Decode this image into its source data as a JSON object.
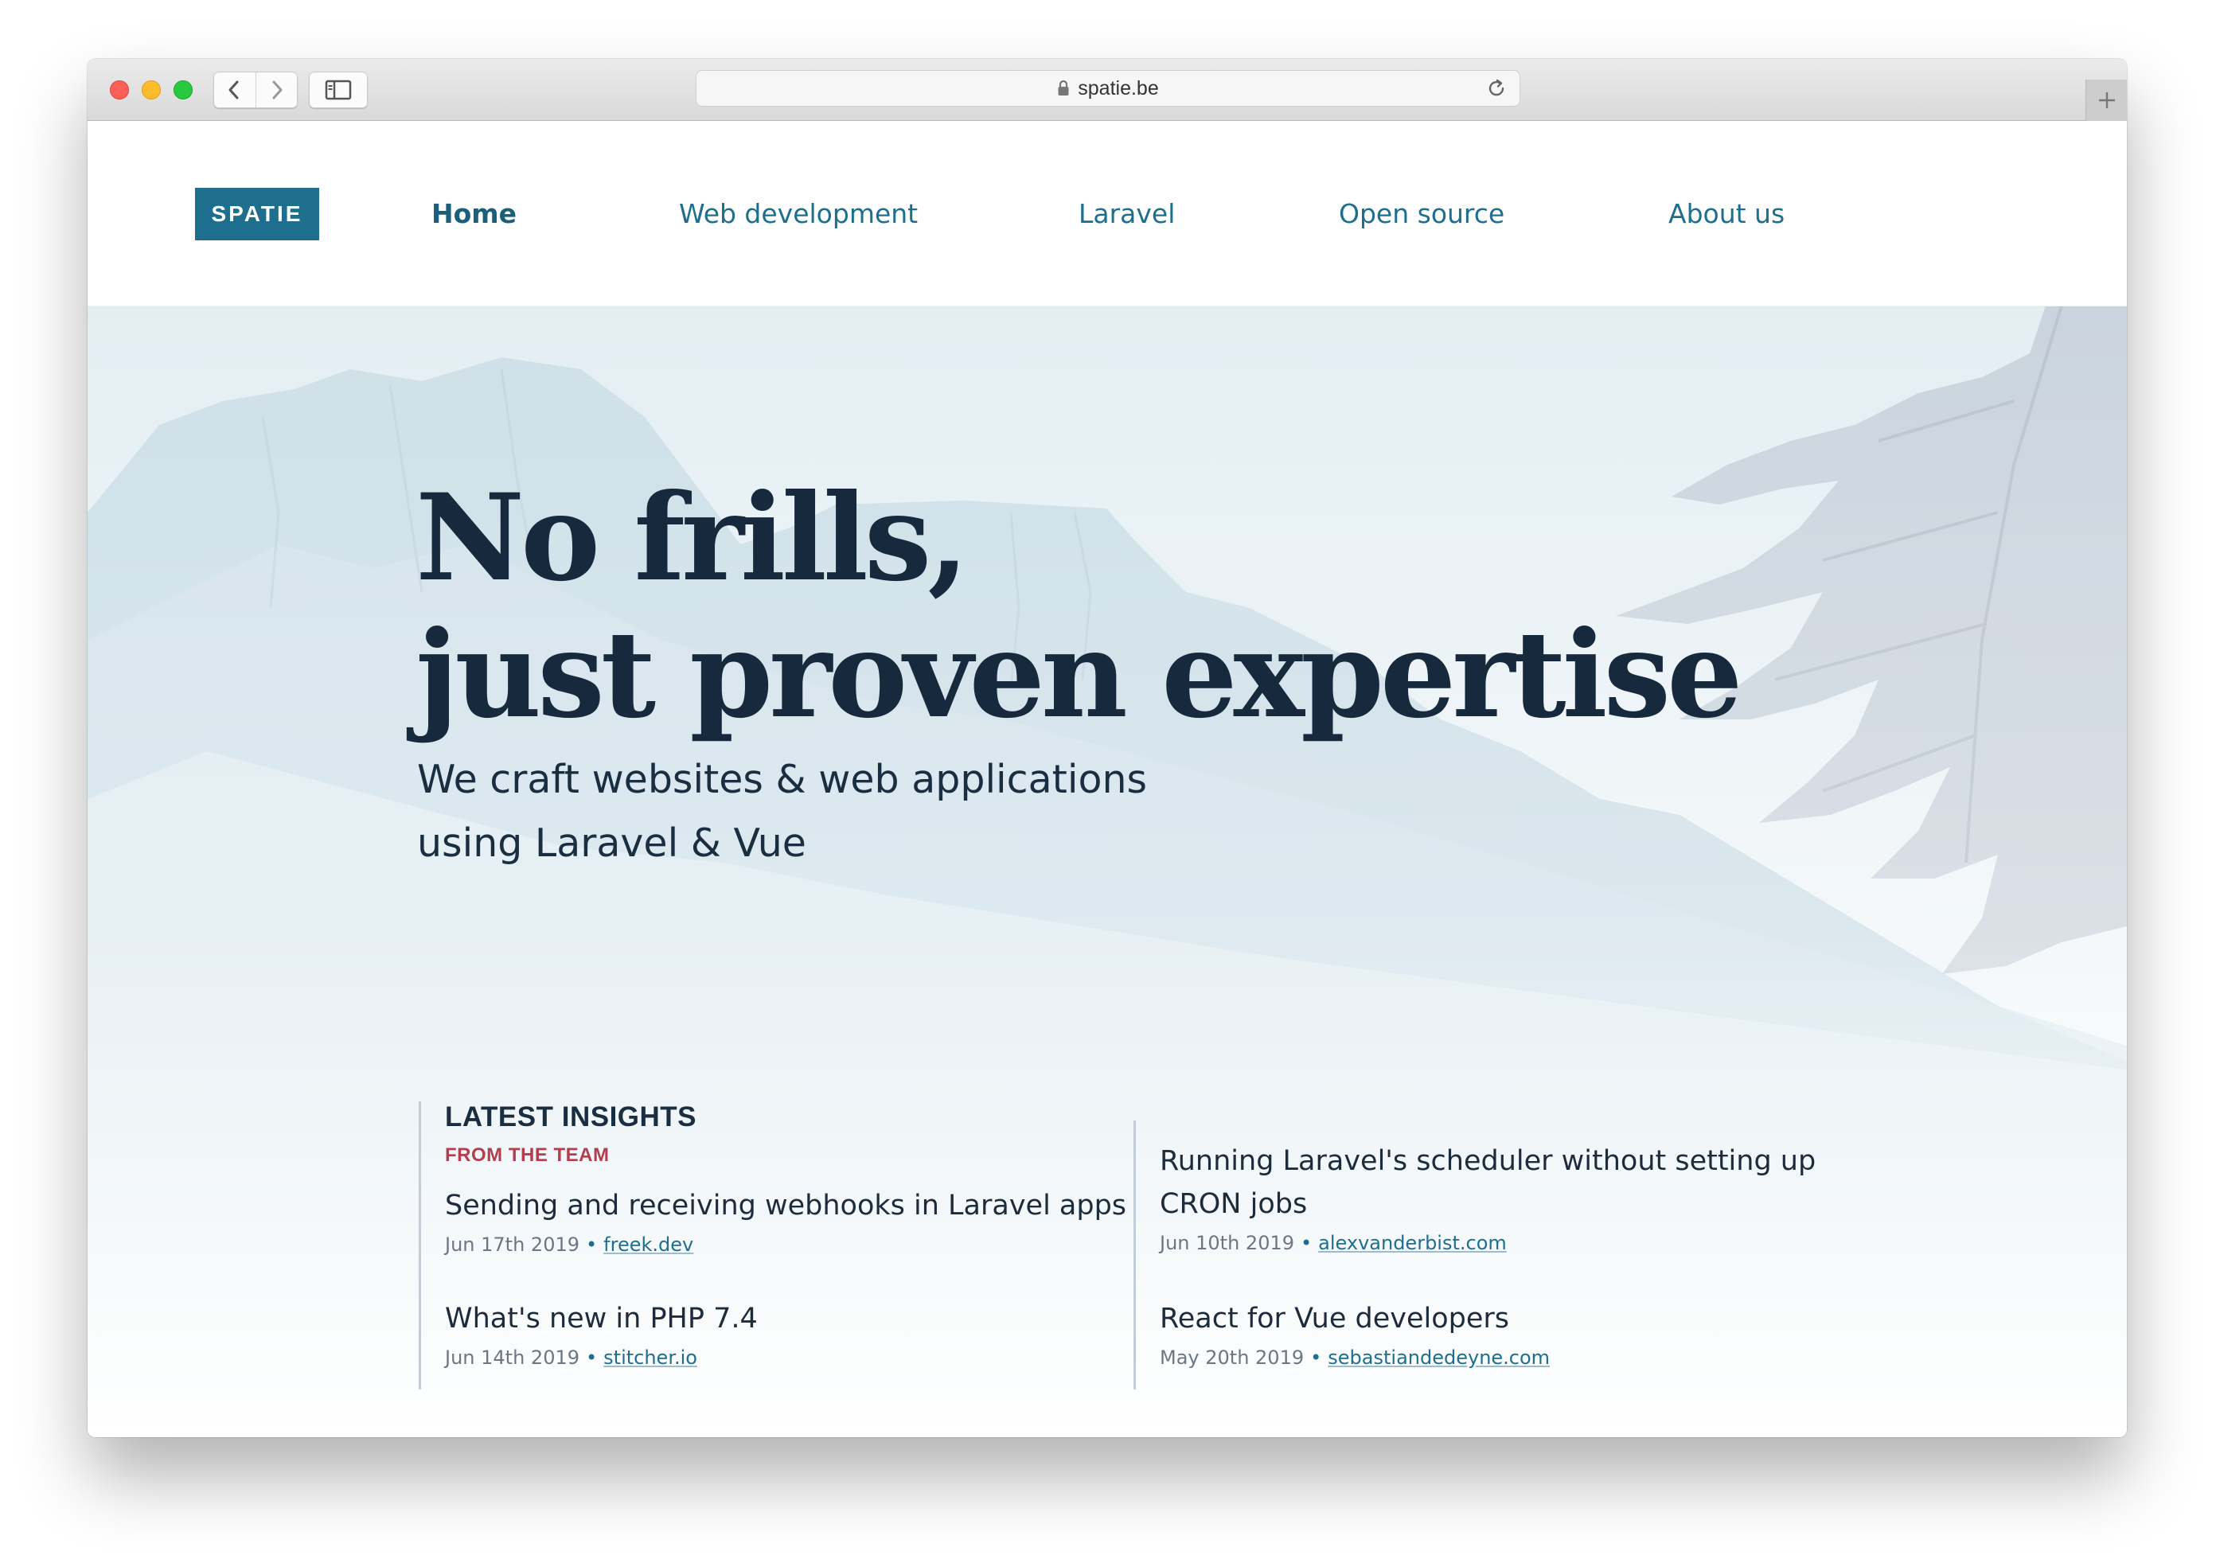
{
  "browser": {
    "url": "spatie.be"
  },
  "site": {
    "logo": "SPATIE",
    "nav": [
      {
        "label": "Home",
        "active": true
      },
      {
        "label": "Web development"
      },
      {
        "label": "Laravel"
      },
      {
        "label": "Open source"
      },
      {
        "label": "About us"
      }
    ]
  },
  "hero": {
    "headline_line1": "No frills,",
    "headline_line2": "just proven expertise",
    "subtitle_line1": "We craft websites & web applications",
    "subtitle_line2": "using Laravel & Vue"
  },
  "insights": {
    "title": "LATEST INSIGHTS",
    "subtitle": "FROM THE TEAM",
    "articles": [
      {
        "title": "Sending and receiving webhooks in Laravel apps",
        "date": "Jun 17th 2019",
        "source": "freek.dev"
      },
      {
        "title": "What's new in PHP 7.4",
        "date": "Jun 14th 2019",
        "source": "stitcher.io"
      },
      {
        "title_line1": "Running Laravel's scheduler without setting up",
        "title_line2": "CRON jobs",
        "date": "Jun 10th 2019",
        "source": "alexvanderbist.com"
      },
      {
        "title": "React for Vue developers",
        "date": "May 20th 2019",
        "source": "sebastiandedeyne.com"
      }
    ]
  },
  "colors": {
    "brand": "#1e6f8d",
    "headline": "#172a3d",
    "accent_red": "#b43e50"
  },
  "icons": [
    "lock-icon",
    "reload-icon",
    "chevron-left-icon",
    "chevron-right-icon",
    "sidebar-icon",
    "plus-icon"
  ]
}
